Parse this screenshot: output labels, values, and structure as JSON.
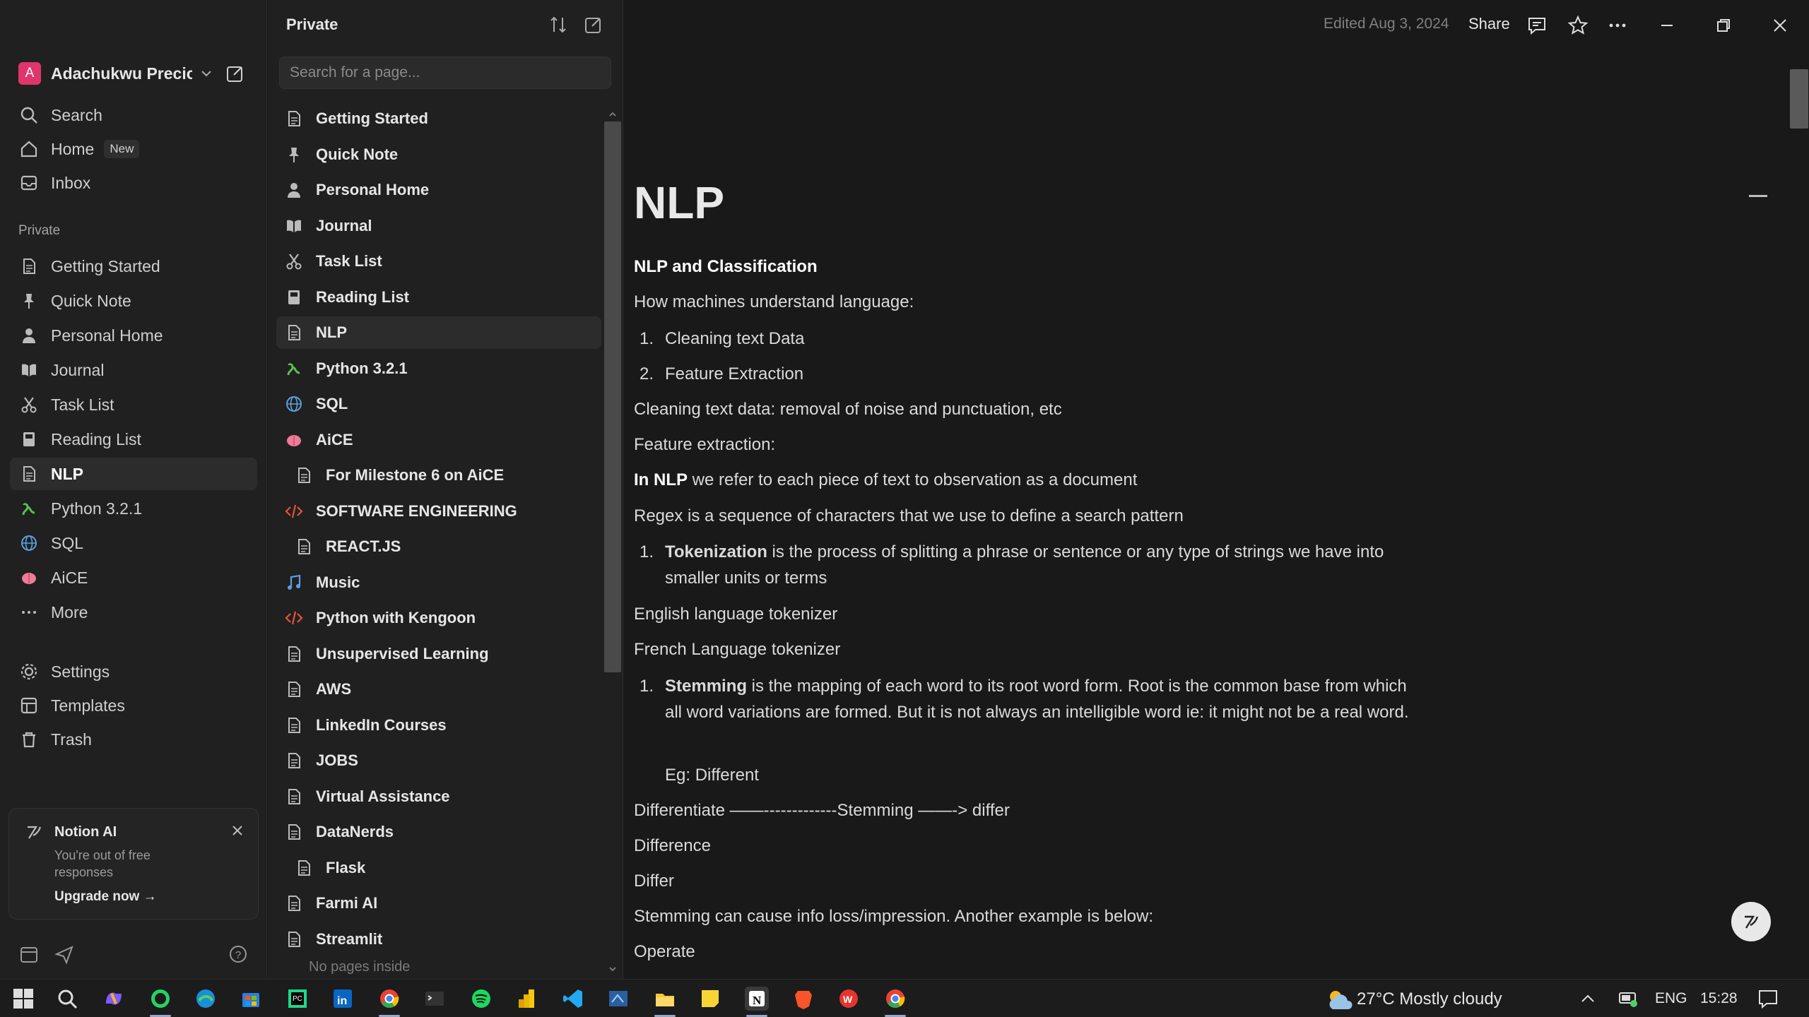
{
  "sidebar": {
    "workspace": {
      "avatar": "A",
      "name": "Adachukwu Precio..."
    },
    "nav": [
      {
        "label": "Search",
        "icon": "search-icon"
      },
      {
        "label": "Home",
        "icon": "home-icon",
        "badge": "New"
      },
      {
        "label": "Inbox",
        "icon": "inbox-icon"
      }
    ],
    "section_label": "Private",
    "private_items": [
      {
        "label": "Getting Started",
        "icon": "page-icon"
      },
      {
        "label": "Quick Note",
        "icon": "pin-icon"
      },
      {
        "label": "Personal Home",
        "icon": "person-icon"
      },
      {
        "label": "Journal",
        "icon": "book-icon"
      },
      {
        "label": "Task List",
        "icon": "scissors-icon"
      },
      {
        "label": "Reading List",
        "icon": "bookshelf-icon"
      },
      {
        "label": "NLP",
        "icon": "page-icon",
        "selected": true
      },
      {
        "label": "Python 3.2.1",
        "icon": "snake-icon"
      },
      {
        "label": "SQL",
        "icon": "globe-icon"
      },
      {
        "label": "AiCE",
        "icon": "brain-icon"
      },
      {
        "label": "More",
        "icon": "more-icon"
      }
    ],
    "footer_items": [
      {
        "label": "Settings",
        "icon": "gear-icon"
      },
      {
        "label": "Templates",
        "icon": "templates-icon"
      },
      {
        "label": "Trash",
        "icon": "trash-icon"
      }
    ],
    "notion_ai": {
      "title": "Notion AI",
      "subtitle": "You're out of free responses",
      "upgrade": "Upgrade now"
    }
  },
  "page_panel": {
    "title": "Private",
    "search_placeholder": "Search for a page...",
    "pages": [
      {
        "label": "Getting Started",
        "icon": "page-icon"
      },
      {
        "label": "Quick Note",
        "icon": "pin-icon"
      },
      {
        "label": "Personal Home",
        "icon": "person-icon"
      },
      {
        "label": "Journal",
        "icon": "book-icon"
      },
      {
        "label": "Task List",
        "icon": "scissors-icon"
      },
      {
        "label": "Reading List",
        "icon": "bookshelf-icon"
      },
      {
        "label": "NLP",
        "icon": "page-icon",
        "selected": true
      },
      {
        "label": "Python 3.2.1",
        "icon": "snake-icon"
      },
      {
        "label": "SQL",
        "icon": "globe-icon"
      },
      {
        "label": "AiCE",
        "icon": "brain-icon"
      },
      {
        "label": "For Milestone 6 on AiCE",
        "icon": "page-icon",
        "sub": true
      },
      {
        "label": "SOFTWARE ENGINEERING",
        "icon": "code-icon"
      },
      {
        "label": "REACT.JS",
        "icon": "page-icon",
        "sub": true
      },
      {
        "label": "Music",
        "icon": "music-icon"
      },
      {
        "label": "Python with Kengoon",
        "icon": "code-icon"
      },
      {
        "label": "Unsupervised Learning",
        "icon": "page-icon"
      },
      {
        "label": "AWS",
        "icon": "page-icon"
      },
      {
        "label": "LinkedIn Courses",
        "icon": "page-icon"
      },
      {
        "label": "JOBS",
        "icon": "page-icon"
      },
      {
        "label": "Virtual Assistance",
        "icon": "page-icon"
      },
      {
        "label": "DataNerds",
        "icon": "page-icon"
      },
      {
        "label": "Flask",
        "icon": "page-icon",
        "sub": true
      },
      {
        "label": "Farmi AI",
        "icon": "page-icon"
      },
      {
        "label": "Streamlit",
        "icon": "page-icon"
      }
    ],
    "empty_text": "No pages inside"
  },
  "topbar": {
    "edited": "Edited Aug 3, 2024",
    "share": "Share"
  },
  "doc": {
    "title": "NLP",
    "heading": "NLP and Classification",
    "intro": "How machines understand language:",
    "list1": [
      "Cleaning text Data",
      "Feature Extraction"
    ],
    "p1": "Cleaning text data: removal of noise and punctuation, etc",
    "p2": "Feature extraction:",
    "p3_bold": "In  NLP",
    "p3_rest": "  we refer to each piece of text to observation as a document",
    "p4": "Regex is a sequence of characters that we use to  define a search pattern",
    "tok_bold": "Tokenization",
    "tok_rest": " is the process of splitting a phrase or sentence or any type of strings we have into smaller units or terms",
    "p5": "English language tokenizer",
    "p6": "French Language tokenizer",
    "stem_bold": "Stemming",
    "stem_rest": " is the mapping of each word to its root word form. Root is the common base from which all word variations are formed. But it is not always an intelligible word ie: it might not be a real word.",
    "eg": "Eg:   Different",
    "p7": "Differentiate     ——-------------Stemming ——-> differ",
    "p8": "Difference",
    "p9": "Differ",
    "p10": "Stemming can cause info loss/impression. Another example is below:",
    "p11": "Operate"
  },
  "taskbar": {
    "weather": "27°C  Mostly cloudy",
    "lang": "ENG",
    "time": "15:28"
  },
  "colors": {
    "accent_pink": "#e0356a",
    "bg_main": "#191919",
    "bg_sidebar": "#202020"
  }
}
